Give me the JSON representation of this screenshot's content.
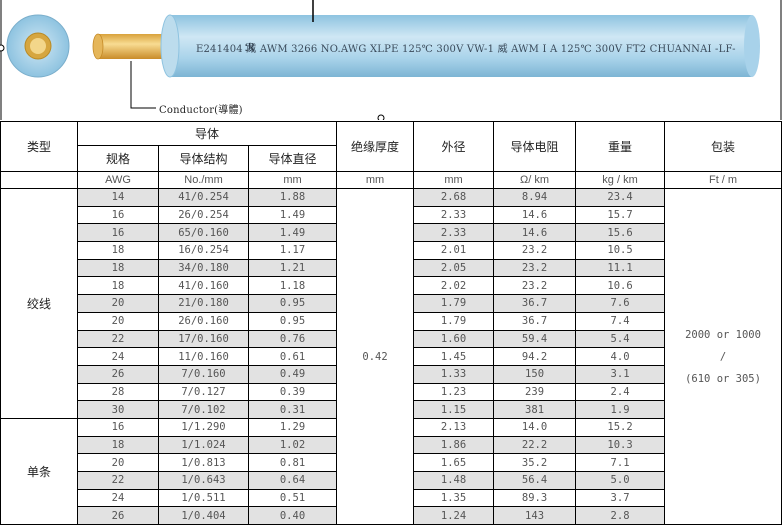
{
  "header": {
    "marking": "E241404  威 AWM 3266 NO.AWG XLPE 125℃ 300V VW-1  威 AWM I A 125℃ 300V FT2 CHUANNAI   -LF-",
    "conductor_label": "Conductor(導體)"
  },
  "table": {
    "type_header": "类型",
    "conductor_header": "导体",
    "spec_header": "规格",
    "structure_header": "导体结构",
    "diameter_header": "导体直径",
    "insulation_header": "绝缘厚度",
    "od_header": "外径",
    "resistance_header": "导体电阻",
    "weight_header": "重量",
    "package_header": "包装",
    "units": {
      "spec": "AWG",
      "structure": "No./mm",
      "diameter": "mm",
      "insulation": "mm",
      "od": "mm",
      "resistance": "Ω/ km",
      "weight": "kg / km",
      "package": "Ft / m"
    },
    "insulation_value": "0.42",
    "package_value": {
      "line1": "2000 or 1000",
      "line2": "/",
      "line3": "(610 or 305)"
    },
    "groups": [
      {
        "type": "绞线",
        "rows": [
          [
            "14",
            "41/0.254",
            "1.88",
            "2.68",
            "8.94",
            "23.4"
          ],
          [
            "16",
            "26/0.254",
            "1.49",
            "2.33",
            "14.6",
            "15.7"
          ],
          [
            "16",
            "65/0.160",
            "1.49",
            "2.33",
            "14.6",
            "15.6"
          ],
          [
            "18",
            "16/0.254",
            "1.17",
            "2.01",
            "23.2",
            "10.5"
          ],
          [
            "18",
            "34/0.180",
            "1.21",
            "2.05",
            "23.2",
            "11.1"
          ],
          [
            "18",
            "41/0.160",
            "1.18",
            "2.02",
            "23.2",
            "10.6"
          ],
          [
            "20",
            "21/0.180",
            "0.95",
            "1.79",
            "36.7",
            "7.6"
          ],
          [
            "20",
            "26/0.160",
            "0.95",
            "1.79",
            "36.7",
            "7.4"
          ],
          [
            "22",
            "17/0.160",
            "0.76",
            "1.60",
            "59.4",
            "5.4"
          ],
          [
            "24",
            "11/0.160",
            "0.61",
            "1.45",
            "94.2",
            "4.0"
          ],
          [
            "26",
            "7/0.160",
            "0.49",
            "1.33",
            "150",
            "3.1"
          ],
          [
            "28",
            "7/0.127",
            "0.39",
            "1.23",
            "239",
            "2.4"
          ],
          [
            "30",
            "7/0.102",
            "0.31",
            "1.15",
            "381",
            "1.9"
          ]
        ]
      },
      {
        "type": "单条",
        "rows": [
          [
            "16",
            "1/1.290",
            "1.29",
            "2.13",
            "14.0",
            "15.2"
          ],
          [
            "18",
            "1/1.024",
            "1.02",
            "1.86",
            "22.2",
            "10.3"
          ],
          [
            "20",
            "1/0.813",
            "0.81",
            "1.65",
            "35.2",
            "7.1"
          ],
          [
            "22",
            "1/0.643",
            "0.64",
            "1.48",
            "56.4",
            "5.0"
          ],
          [
            "24",
            "1/0.511",
            "0.51",
            "1.35",
            "89.3",
            "3.7"
          ],
          [
            "26",
            "1/0.404",
            "0.40",
            "1.24",
            "143",
            "2.8"
          ]
        ]
      }
    ]
  }
}
